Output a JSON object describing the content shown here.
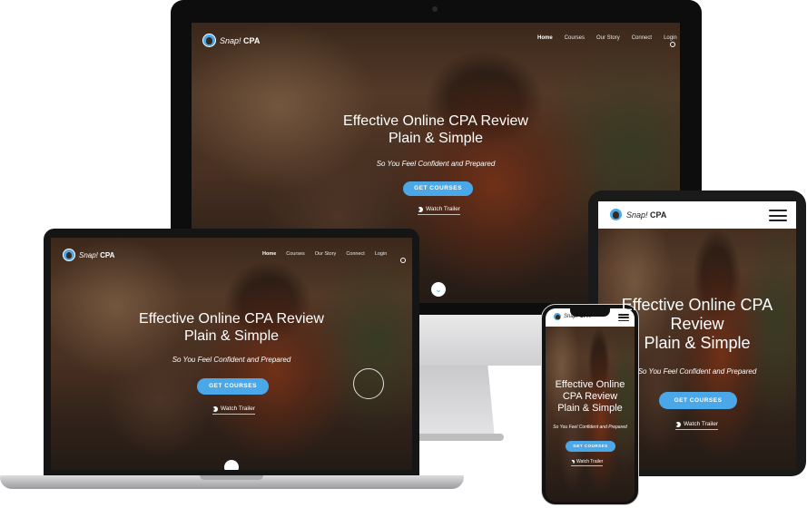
{
  "brand": {
    "name_italic": "Snap!",
    "name_bold": "CPA"
  },
  "nav": [
    "Home",
    "Courses",
    "Our Story",
    "Connect",
    "Login"
  ],
  "hero": {
    "line1": "Effective Online CPA Review",
    "line2": "Plain & Simple",
    "subline": "So You Feel Confident and Prepared",
    "cta": "GET COURSES",
    "trailer": "Watch Trailer"
  },
  "ipad": {
    "line1": "Effective Online CPA",
    "line2": "Review",
    "line3": "Plain & Simple"
  },
  "iphone": {
    "line1": "Effective Online",
    "line2": "CPA Review",
    "line3": "Plain & Simple"
  },
  "colors": {
    "accent": "#4aa8e8",
    "device_frame": "#151515",
    "aluminum": "#d8d8da"
  }
}
